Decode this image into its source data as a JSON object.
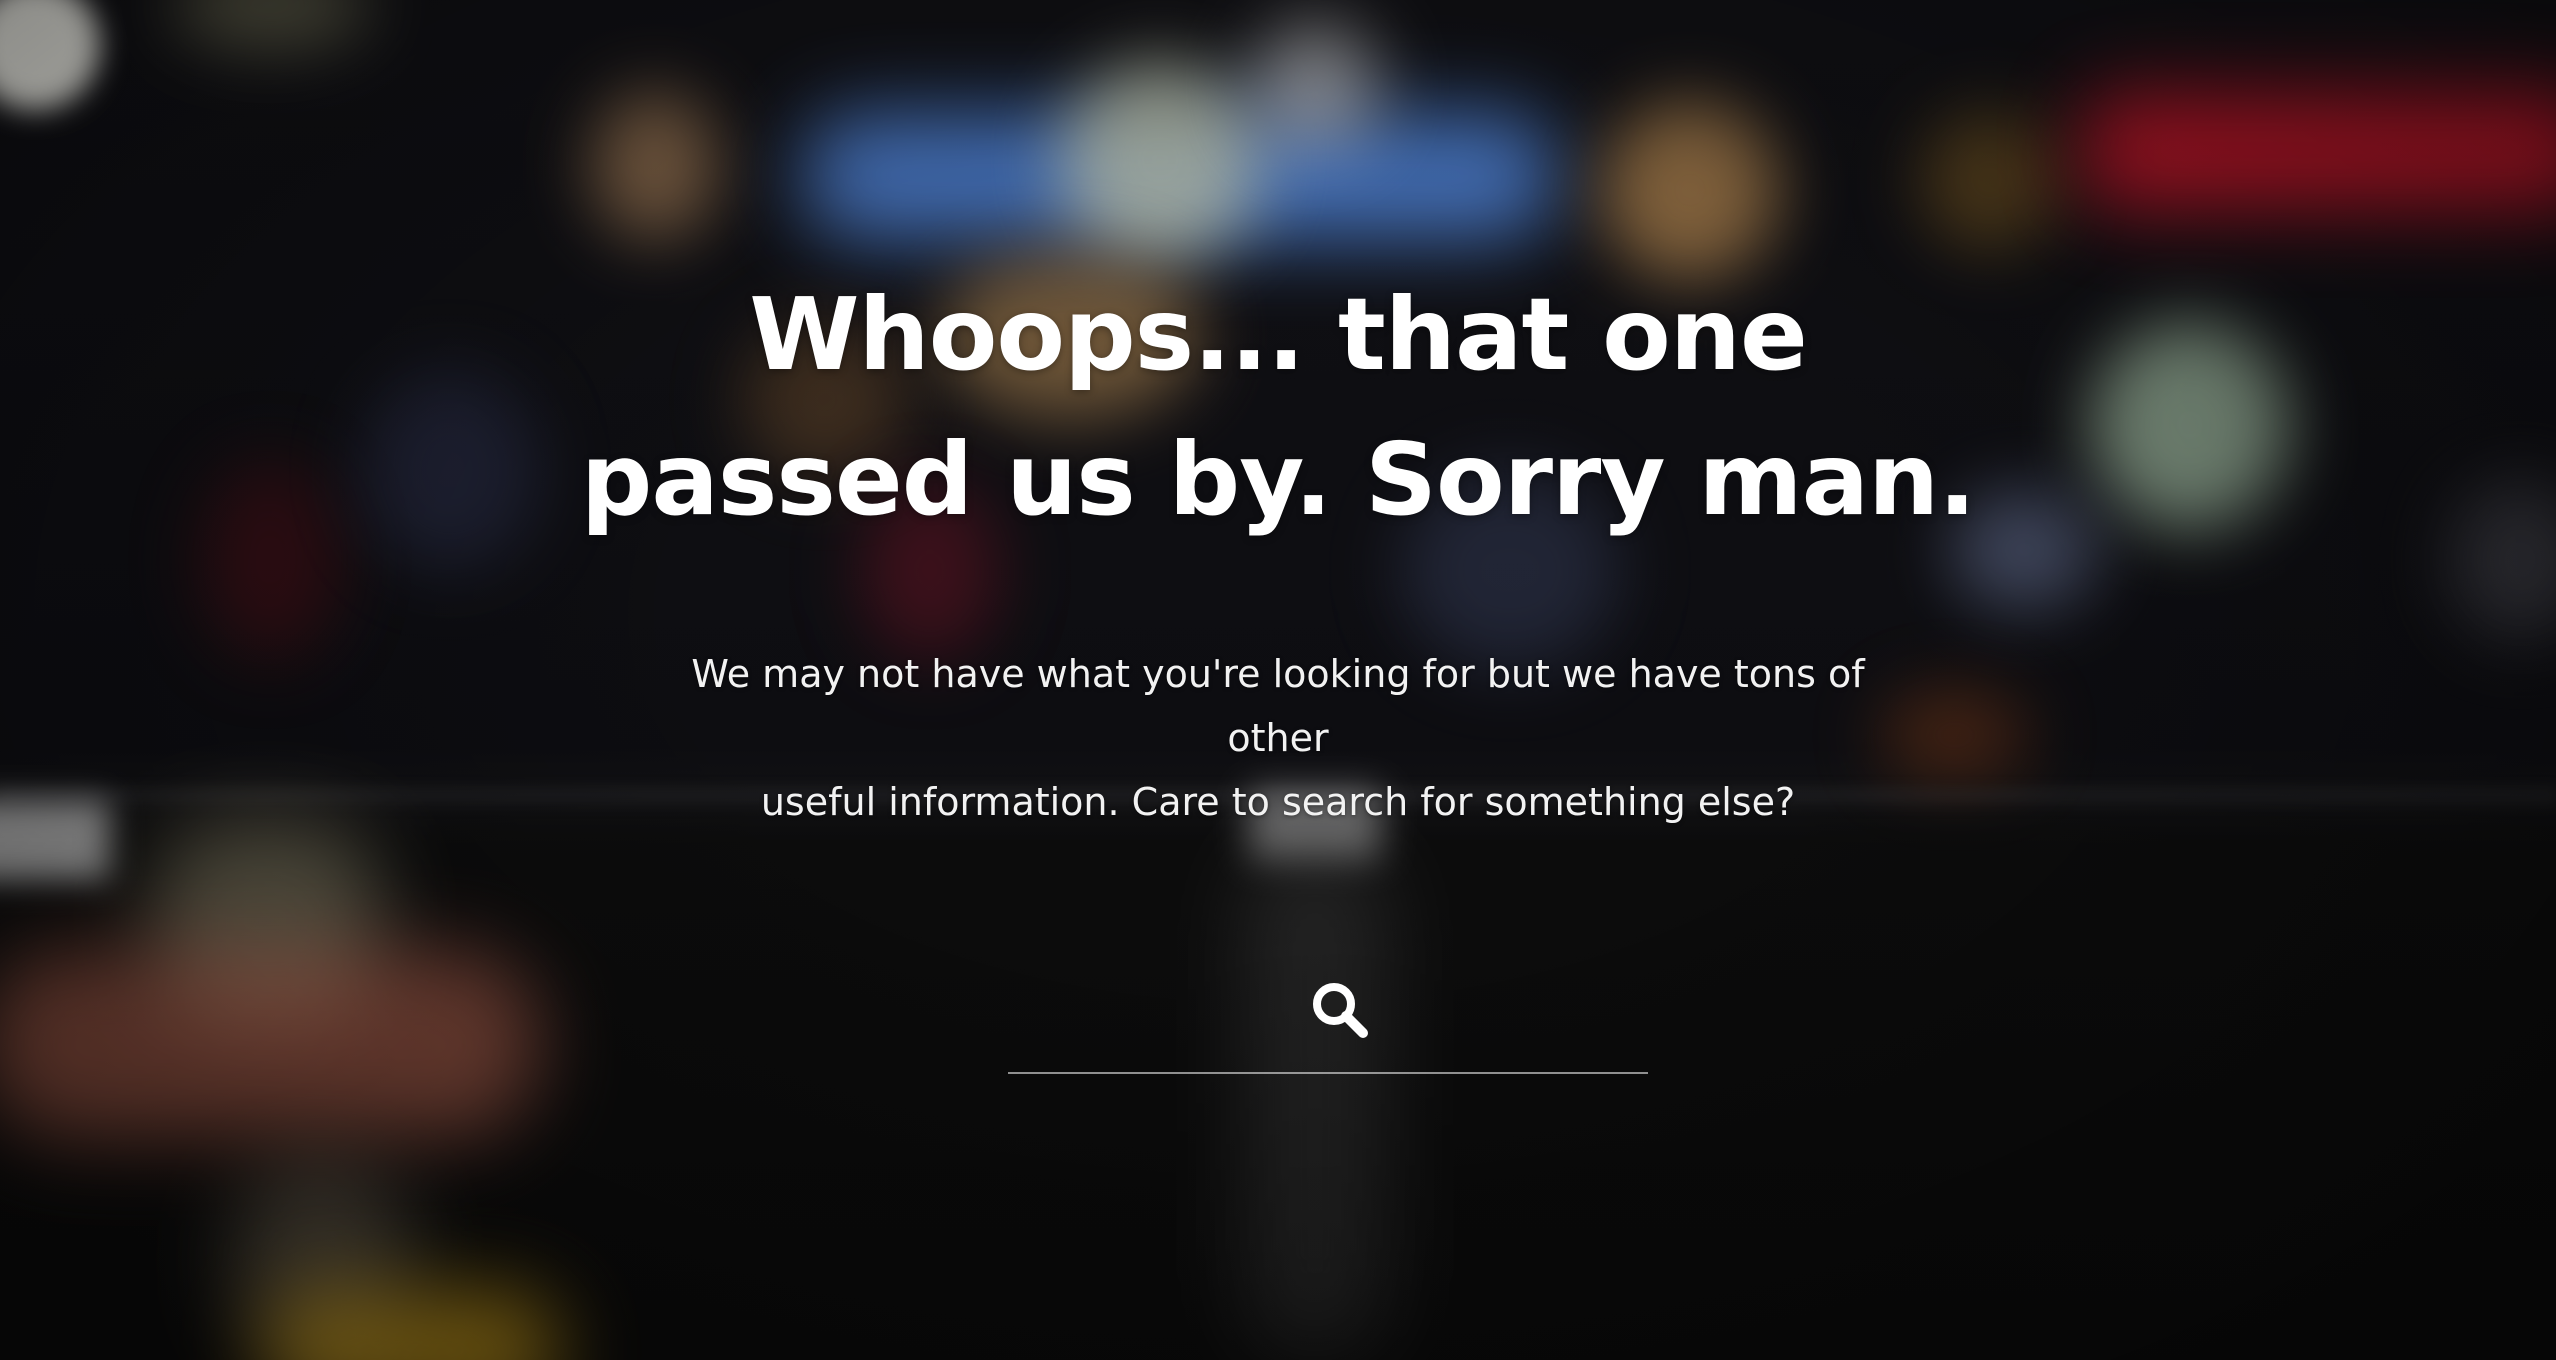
{
  "error_page": {
    "headline_line1": "Whoops... that one",
    "headline_line2": "passed us by. Sorry man.",
    "message_line1": "We may not have what you're looking for but we have tons of other",
    "message_line2": "useful information. Care to search for something else?"
  },
  "search": {
    "icon": "search-icon",
    "value": "",
    "placeholder": ""
  },
  "colors": {
    "text": "#ffffff",
    "background": "#0b0b0c",
    "underline": "#8c8c8c"
  }
}
